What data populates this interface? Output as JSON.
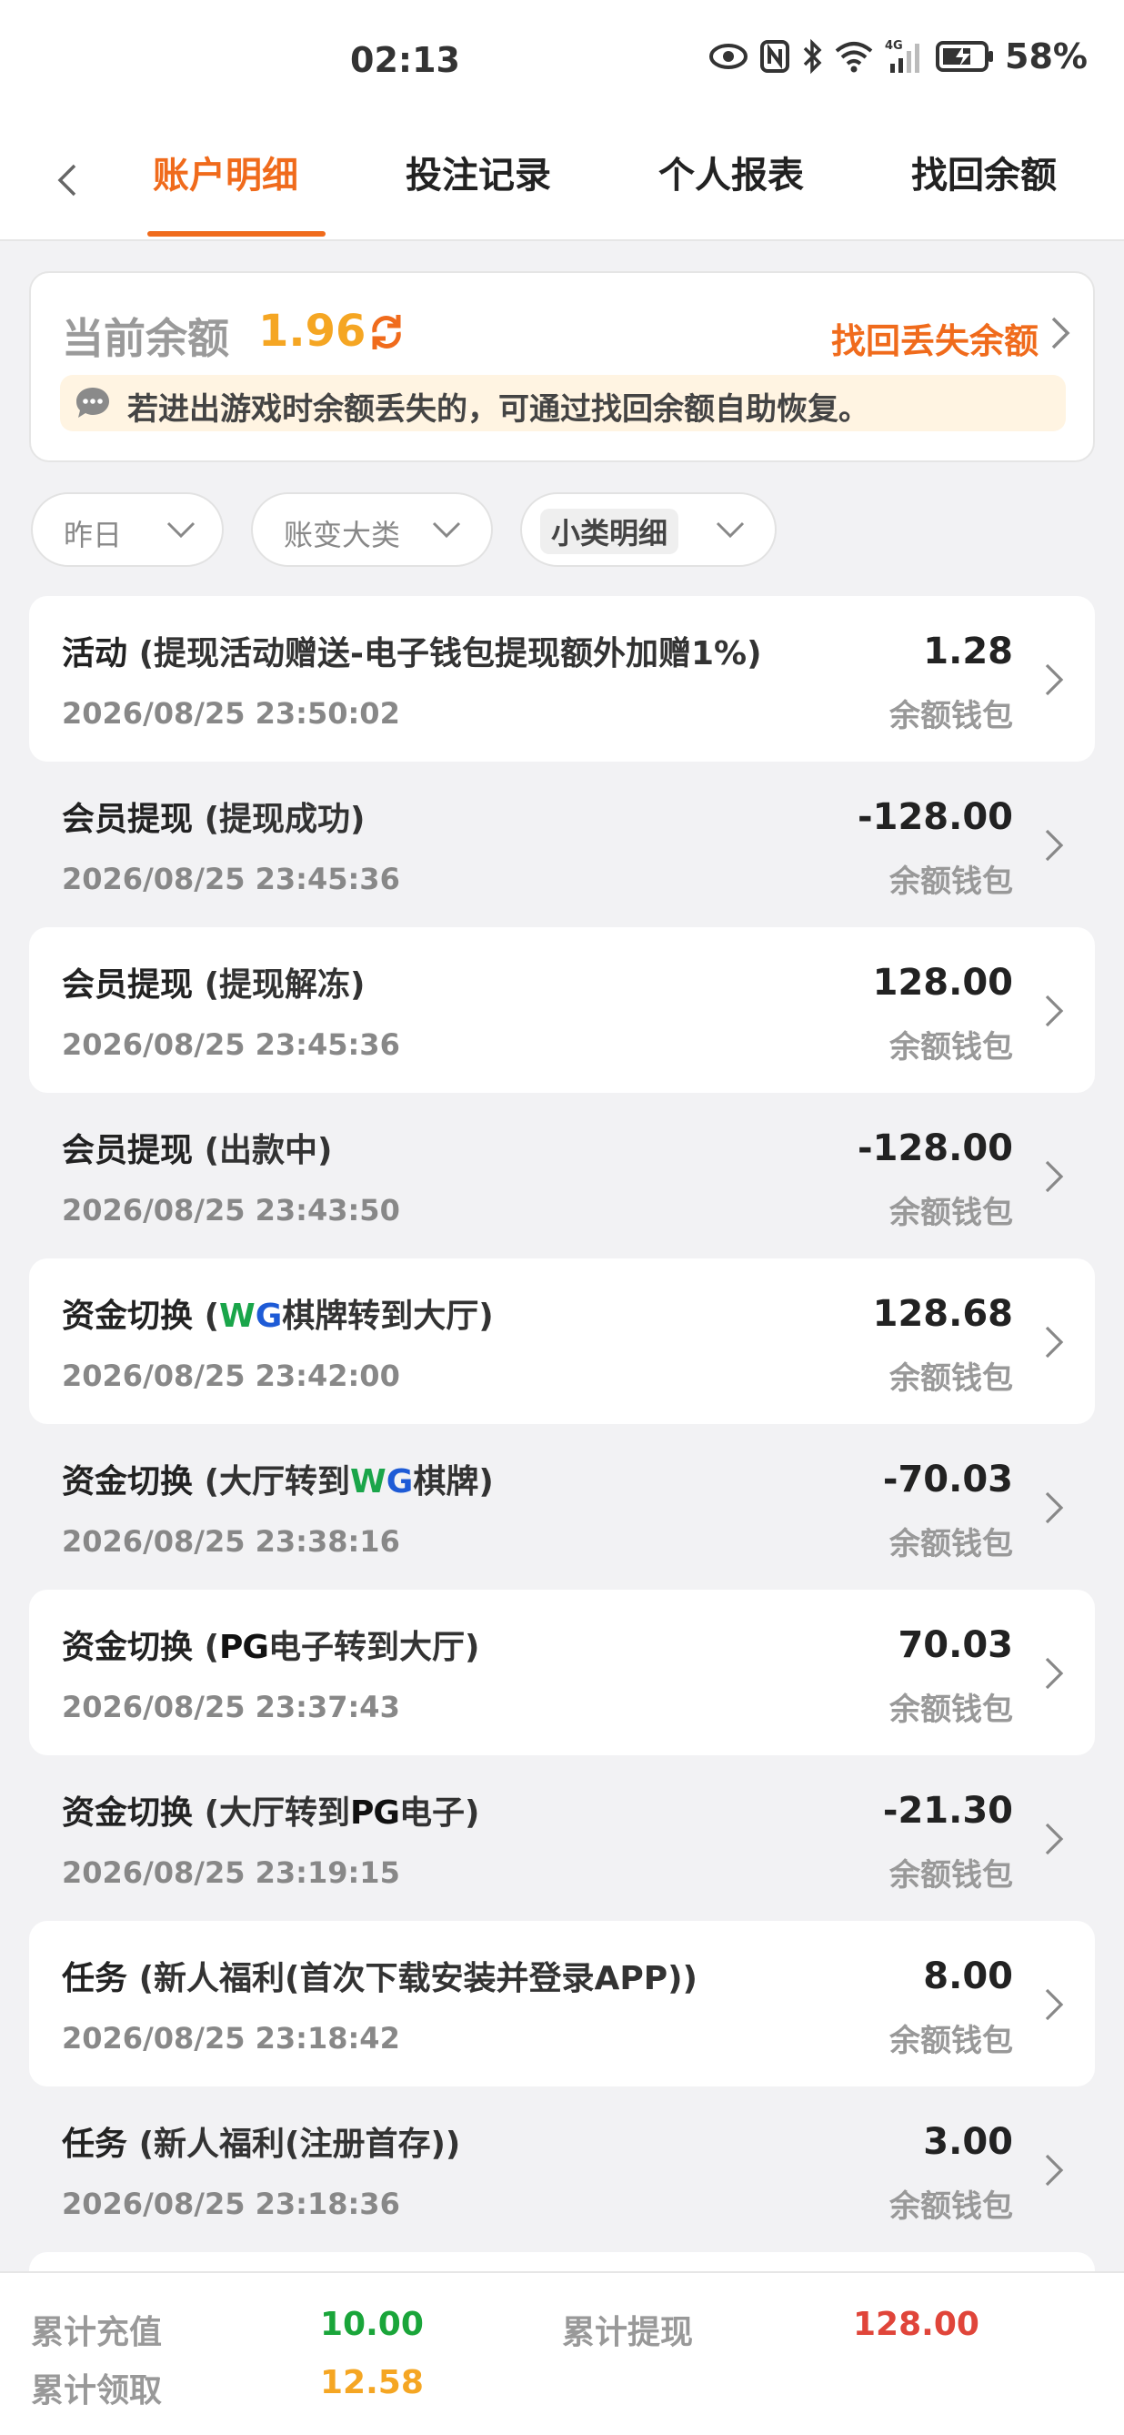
{
  "status_bar": {
    "time": "02:13",
    "battery": "58%",
    "icons": [
      "eye-icon",
      "nfc-icon",
      "bluetooth-icon",
      "wifi-icon",
      "signal-4g-icon",
      "battery-icon"
    ]
  },
  "tabs": {
    "back_icon": "chevron-left-icon",
    "items": [
      {
        "label": "账户明细",
        "active": true
      },
      {
        "label": "投注记录",
        "active": false
      },
      {
        "label": "个人报表",
        "active": false
      },
      {
        "label": "找回余额",
        "active": false
      }
    ],
    "accent": "#f06b1c"
  },
  "balance": {
    "label": "当前余额",
    "value": "1.96",
    "value_color": "#f5a623",
    "refresh_icon": "refresh-icon",
    "recover_link": "找回丢失余额",
    "notice": "若进出游戏时余额丢失的，可通过找回余额自助恢复。",
    "notice_icon": "chat-bubble-icon"
  },
  "filters": [
    {
      "label": "昨日",
      "selected": false
    },
    {
      "label": "账变大类",
      "selected": false
    },
    {
      "label": "小类明细",
      "selected": true
    }
  ],
  "transactions": [
    {
      "category": "活动",
      "detail": "(提现活动赠送-电子钱包提现额外加赠1%)",
      "time": "2026/08/25 23:50:02",
      "amount": "1.28",
      "wallet": "余额钱包"
    },
    {
      "category": "会员提现",
      "detail": "(提现成功)",
      "time": "2026/08/25 23:45:36",
      "amount": "-128.00",
      "wallet": "余额钱包"
    },
    {
      "category": "会员提现",
      "detail": "(提现解冻)",
      "time": "2026/08/25 23:45:36",
      "amount": "128.00",
      "wallet": "余额钱包"
    },
    {
      "category": "会员提现",
      "detail": "(出款中)",
      "time": "2026/08/25 23:43:50",
      "amount": "-128.00",
      "wallet": "余额钱包"
    },
    {
      "category": "资金切换",
      "detail_pre": "(",
      "brand": "WG",
      "detail_post": "棋牌转到大厅)",
      "time": "2026/08/25 23:42:00",
      "amount": "128.68",
      "wallet": "余额钱包"
    },
    {
      "category": "资金切换",
      "detail_pre": "(大厅转到",
      "brand": "WG",
      "detail_post": "棋牌)",
      "time": "2026/08/25 23:38:16",
      "amount": "-70.03",
      "wallet": "余额钱包"
    },
    {
      "category": "资金切换",
      "detail_pre": "(",
      "brand": "PG",
      "detail_post": "电子转到大厅)",
      "time": "2026/08/25 23:37:43",
      "amount": "70.03",
      "wallet": "余额钱包"
    },
    {
      "category": "资金切换",
      "detail_pre": "(大厅转到",
      "brand": "PG",
      "detail_post": "电子)",
      "time": "2026/08/25 23:19:15",
      "amount": "-21.30",
      "wallet": "余额钱包"
    },
    {
      "category": "任务",
      "detail": "(新人福利(首次下载安装并登录APP))",
      "time": "2026/08/25 23:18:42",
      "amount": "8.00",
      "wallet": "余额钱包"
    },
    {
      "category": "任务",
      "detail": "(新人福利(注册首存))",
      "time": "2026/08/25 23:18:36",
      "amount": "3.00",
      "wallet": "余额钱包"
    }
  ],
  "summary": {
    "deposit_label": "累计充值",
    "deposit_value": "10.00",
    "deposit_color": "#1aa53a",
    "withdraw_label": "累计提现",
    "withdraw_value": "128.00",
    "withdraw_color": "#e0453a",
    "claim_label": "累计领取",
    "claim_value": "12.58",
    "claim_color": "#f5a623"
  }
}
